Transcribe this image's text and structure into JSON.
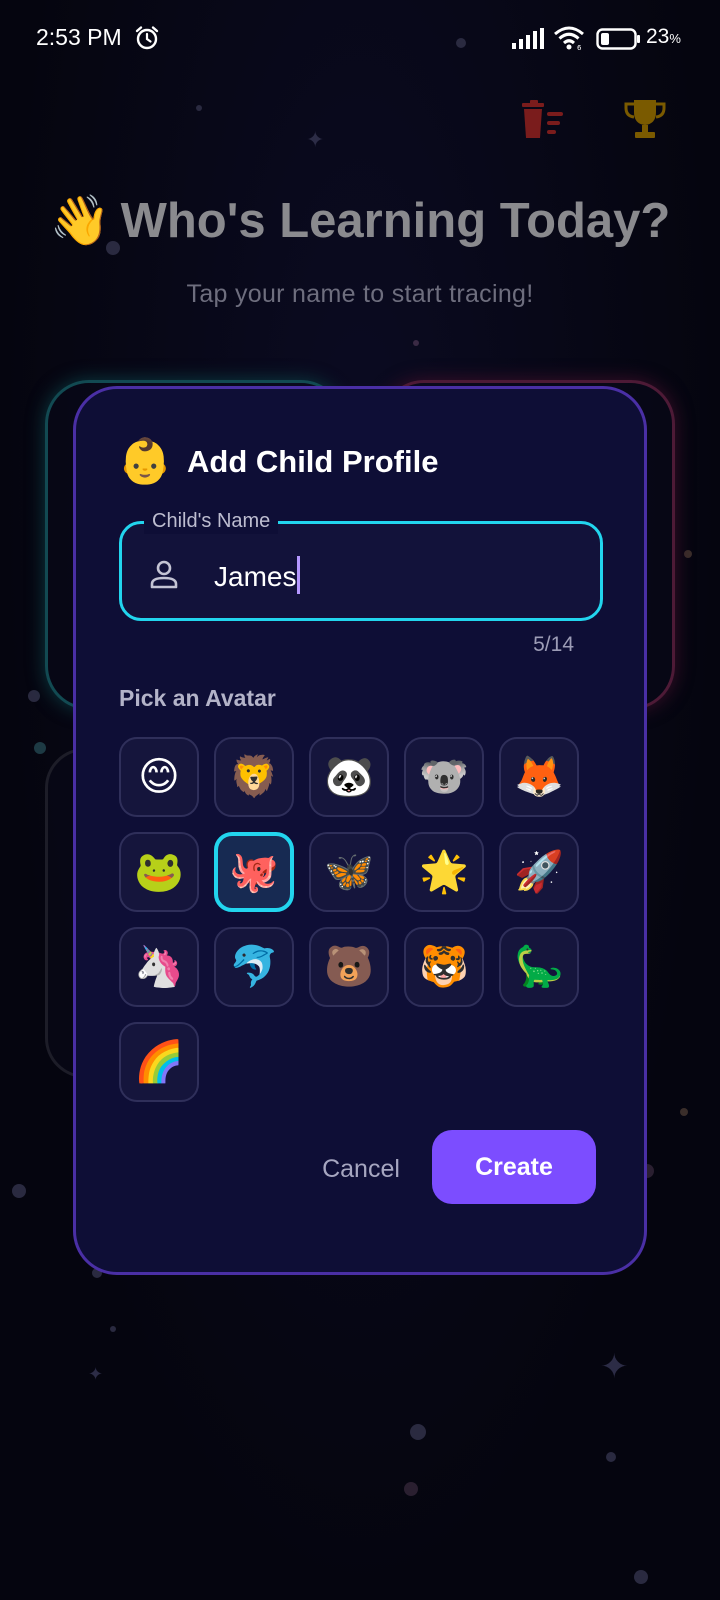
{
  "status_bar": {
    "time": "2:53 PM",
    "battery_value": "23",
    "battery_unit": "%"
  },
  "header": {
    "title_emoji": "👋",
    "title": "Who's Learning Today?",
    "subtitle": "Tap your name to start tracing!"
  },
  "dialog": {
    "title_emoji": "👶",
    "title": "Add Child Profile",
    "name_field": {
      "label": "Child's Name",
      "value": "James",
      "counter": "5/14"
    },
    "avatar_heading": "Pick an Avatar",
    "avatars": [
      "😊",
      "🦁",
      "🐼",
      "🐨",
      "🦊",
      "🐸",
      "🐙",
      "🦋",
      "🌟",
      "🚀",
      "🦄",
      "🐬",
      "🐻",
      "🐯",
      "🦕",
      "🌈"
    ],
    "selected_avatar_index": 6,
    "cancel_label": "Cancel",
    "create_label": "Create"
  },
  "colors": {
    "accent": "#7c4dff",
    "field_border": "#22d5ee",
    "dialog_border": "#4a2fa5",
    "dialog_bg": "#0e0e36"
  }
}
